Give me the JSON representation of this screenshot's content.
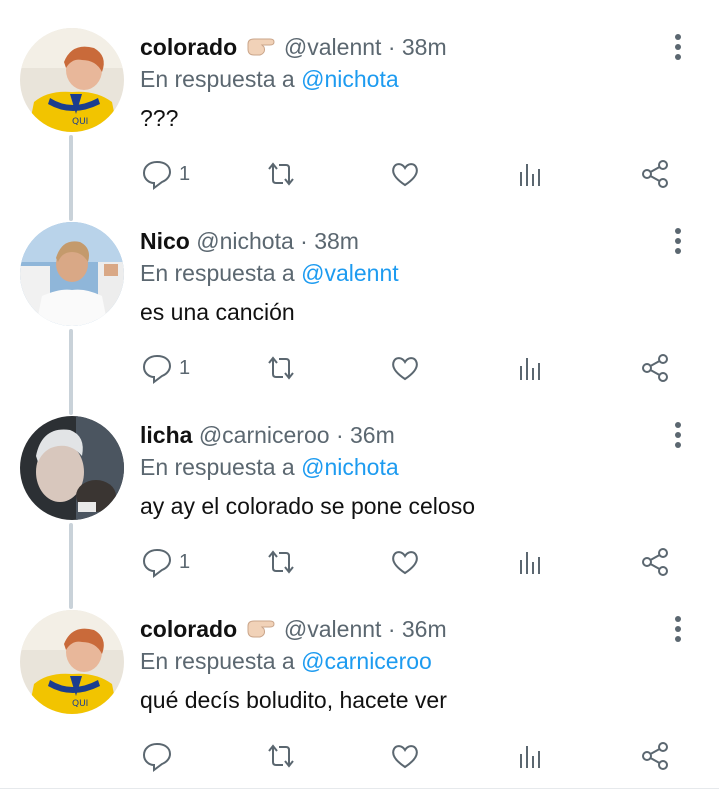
{
  "tweets": [
    {
      "name": "colorado",
      "handle": "@valennt",
      "time": "· 38m",
      "reply_prefix": "En respuesta a",
      "reply_to": "@nichota",
      "text": "???",
      "reply_count": "1",
      "avatar": "boca-jersey",
      "has_emoji": true
    },
    {
      "name": "Nico",
      "handle": "@nichota",
      "time": "· 38m",
      "reply_prefix": "En respuesta a",
      "reply_to": "@valennt",
      "text": "es una canción",
      "reply_count": "1",
      "avatar": "white-shirt",
      "has_emoji": false
    },
    {
      "name": "licha",
      "handle": "@carniceroo",
      "time": "· 36m",
      "reply_prefix": "En respuesta a",
      "reply_to": "@nichota",
      "text": "ay ay el colorado se pone celoso",
      "reply_count": "1",
      "avatar": "dark-selfie",
      "has_emoji": false
    },
    {
      "name": "colorado",
      "handle": "@valennt",
      "time": "· 36m",
      "reply_prefix": "En respuesta a",
      "reply_to": "@carniceroo",
      "text": "qué decís boludito, hacete ver",
      "reply_count": "",
      "avatar": "boca-jersey",
      "has_emoji": true
    }
  ],
  "colors": {
    "accent": "#1d9bf0",
    "secondary_text": "#5b6770",
    "primary_text": "#111111",
    "thread_line": "#c9d2d9"
  },
  "icons": [
    "reply-icon",
    "retweet-icon",
    "like-icon",
    "analytics-icon",
    "share-icon",
    "more-options-icon",
    "pointing-hand-emoji"
  ]
}
